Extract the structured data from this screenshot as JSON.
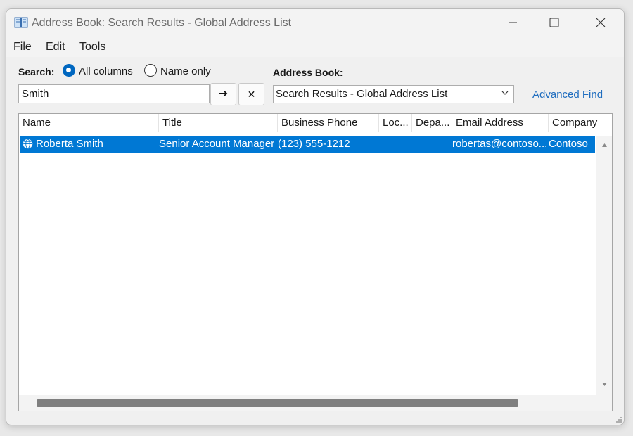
{
  "window": {
    "title": "Address Book: Search Results - Global Address List"
  },
  "menu": {
    "file": "File",
    "edit": "Edit",
    "tools": "Tools"
  },
  "search": {
    "label": "Search:",
    "option_all": "All columns",
    "option_name": "Name only",
    "selected_option": "All columns",
    "value": "Smith",
    "go_glyph": "➔",
    "clear_glyph": "✕"
  },
  "address_book": {
    "label": "Address Book:",
    "selected": "Search Results - Global Address List",
    "advanced_find": "Advanced Find"
  },
  "table": {
    "columns": [
      "Name",
      "Title",
      "Business Phone",
      "Loc...",
      "Depa...",
      "Email Address",
      "Company"
    ],
    "rows": [
      {
        "name": "Roberta Smith",
        "title": "Senior Account Manager",
        "business_phone": "(123) 555-1212",
        "location": "",
        "department": "",
        "email": "robertas@contoso...",
        "company": "Contoso",
        "selected": true,
        "icon": "globe-user-icon"
      }
    ]
  },
  "colors": {
    "selection": "#0078d4",
    "link": "#1f6dbf",
    "radio_accent": "#0067c0"
  }
}
